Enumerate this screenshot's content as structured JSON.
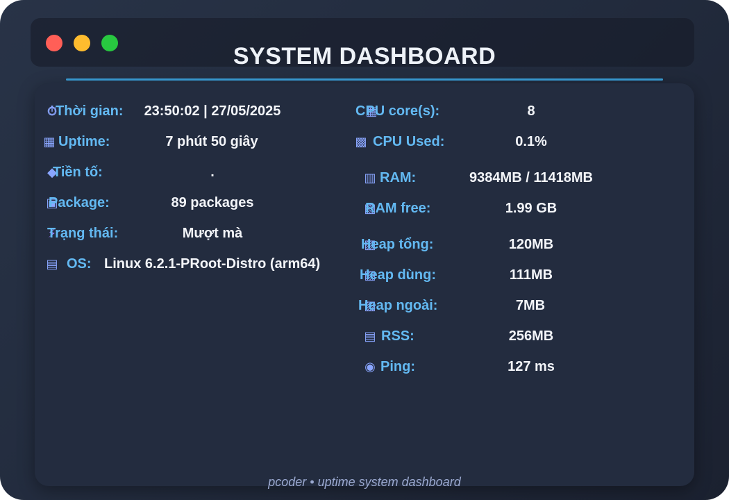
{
  "window": {
    "title": "SYSTEM DASHBOARD",
    "controls": [
      "close",
      "minimize",
      "maximize"
    ]
  },
  "left": {
    "time": {
      "icon": "clock-icon",
      "label": "Thời gian:",
      "value": "23:50:02 | 27/05/2025"
    },
    "uptime": {
      "icon": "calendar-icon",
      "label": "Uptime:",
      "value": "7 phút 50 giây"
    },
    "prefix": {
      "icon": "pin-icon",
      "label": "Tiền tố:",
      "value": "."
    },
    "package": {
      "icon": "package-icon",
      "label": "Package:",
      "value": "89 packages"
    },
    "status": {
      "icon": "bolt-icon",
      "label": "Trạng thái:",
      "value": "Mượt mà"
    },
    "os": {
      "icon": "clipboard-icon",
      "label": "OS:",
      "value": "Linux 6.2.1-PRoot-Distro (arm64)"
    }
  },
  "right": {
    "cpu_cores": {
      "icon": "cpu-icon",
      "label": "CPU core(s):",
      "value": "8"
    },
    "cpu_used": {
      "icon": "cpu-chart-icon",
      "label": "CPU Used:",
      "value": "0.1%"
    },
    "ram": {
      "icon": "chart-icon",
      "label": "RAM:",
      "value": "9384MB / 11418MB"
    },
    "ram_free": {
      "icon": "memory-icon",
      "label": "RAM free:",
      "value": "1.99 GB"
    },
    "heap_total": {
      "icon": "heap-icon",
      "label": "Heap tổng:",
      "value": "120MB"
    },
    "heap_used": {
      "icon": "heap-used-icon",
      "label": "Heap dùng:",
      "value": "111MB"
    },
    "heap_external": {
      "icon": "heap-external-icon",
      "label": "Heap ngoài:",
      "value": "7MB"
    },
    "rss": {
      "icon": "rss-icon",
      "label": "RSS:",
      "value": "256MB"
    },
    "ping": {
      "icon": "ping-icon",
      "label": "Ping:",
      "value": "127 ms"
    }
  },
  "footer": {
    "text": "pcoder • uptime system dashboard"
  },
  "colors": {
    "accent": "#3a9fd8",
    "label": "#63b9f2",
    "value": "#f3f5f9",
    "close": "#ff5f57",
    "minimize": "#febc2e",
    "maximize": "#28c840"
  }
}
